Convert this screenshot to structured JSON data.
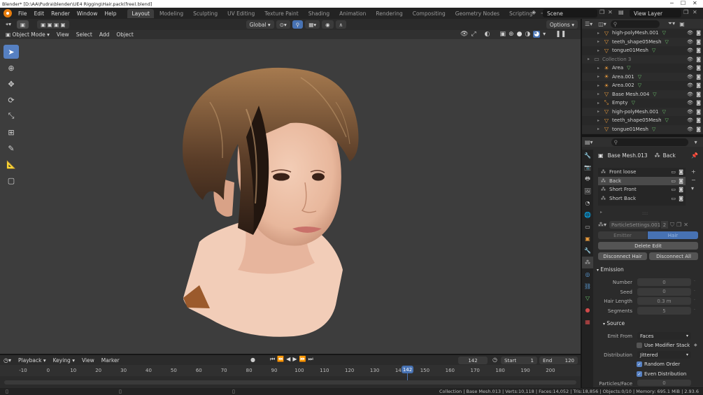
{
  "titlebar": {
    "title": "Blender* [D:\\AA\\Pudra\\blender\\UE4 Rigging\\Hair.pack(free).blend]"
  },
  "menu": [
    "File",
    "Edit",
    "Render",
    "Window",
    "Help"
  ],
  "workspaces": [
    "Layout",
    "Modeling",
    "Sculpting",
    "UV Editing",
    "Texture Paint",
    "Shading",
    "Animation",
    "Rendering",
    "Compositing",
    "Geometry Nodes",
    "Scripting"
  ],
  "scene": {
    "name": "Scene",
    "view_layer": "View Layer"
  },
  "viewport_header": {
    "mode": "Object Mode",
    "menus": [
      "View",
      "Select",
      "Add",
      "Object"
    ],
    "transform": "Global",
    "options": "Options"
  },
  "outliner": {
    "search_placeholder": "",
    "rows": [
      {
        "name": "high-polyMesh.001",
        "icon": "mesh-icon",
        "indent": 1
      },
      {
        "name": "teeth_shape05Mesh",
        "icon": "mesh-icon",
        "indent": 1
      },
      {
        "name": "tongue01Mesh",
        "icon": "mesh-icon",
        "indent": 1
      },
      {
        "name": "Collection 3",
        "icon": "collection-icon",
        "indent": 0,
        "dim": true
      },
      {
        "name": "Area",
        "icon": "light-icon",
        "indent": 1
      },
      {
        "name": "Area.001",
        "icon": "light-icon",
        "indent": 1
      },
      {
        "name": "Area.002",
        "icon": "light-icon",
        "indent": 1
      },
      {
        "name": "Base Mesh.004",
        "icon": "mesh-icon",
        "indent": 1
      },
      {
        "name": "Empty",
        "icon": "empty-icon",
        "indent": 1
      },
      {
        "name": "high-polyMesh.001",
        "icon": "mesh-icon",
        "indent": 1
      },
      {
        "name": "teeth_shape05Mesh",
        "icon": "mesh-icon",
        "indent": 1
      },
      {
        "name": "tongue01Mesh",
        "icon": "mesh-icon",
        "indent": 1
      }
    ]
  },
  "properties": {
    "object": "Base Mesh.013",
    "system": "Back",
    "particle_systems": [
      "Front loose",
      "Back",
      "Short Front",
      "Short Back"
    ],
    "selected_system": "Back",
    "settings_name": "ParticleSettings.001",
    "users": "2",
    "type_tabs": [
      "Emitter",
      "Hair"
    ],
    "buttons": {
      "delete_edit": "Delete Edit",
      "disconnect_hair": "Disconnect Hair",
      "disconnect_all": "Disconnect All"
    },
    "emission": {
      "title": "Emission",
      "fields": [
        {
          "label": "Number",
          "value": "0"
        },
        {
          "label": "Seed",
          "value": "0"
        },
        {
          "label": "Hair Length",
          "value": "0.3 m"
        },
        {
          "label": "Segments",
          "value": "5"
        }
      ]
    },
    "source": {
      "title": "Source",
      "emit_from_label": "Emit From",
      "emit_from": "Faces",
      "use_modifier_stack": "Use Modifier Stack",
      "distribution_label": "Distribution",
      "distribution": "Jittered",
      "random_order": "Random Order",
      "even_distribution": "Even Distribution",
      "particles_face_label": "Particles/Face",
      "particles_face": "0"
    }
  },
  "timeline": {
    "menus": [
      "Playback",
      "Keying",
      "View",
      "Marker"
    ],
    "current_frame": "142",
    "start_label": "Start",
    "start": "1",
    "end_label": "End",
    "end": "120",
    "ticks": [
      "-10",
      "0",
      "10",
      "20",
      "30",
      "40",
      "50",
      "60",
      "70",
      "80",
      "90",
      "100",
      "110",
      "120",
      "130",
      "140",
      "150",
      "160",
      "170",
      "180",
      "190",
      "200"
    ],
    "playhead": "142"
  },
  "statusbar": {
    "text": "Collection | Base Mesh.013 | Verts:10,118 | Faces:14,052 | Tris:18,856 | Objects:0/10 | Memory: 695.1 MiB | 2.93.6"
  },
  "colors": {
    "accent": "#4772b3",
    "selected_tab": "#5680c2",
    "object_orange": "#e89a3c",
    "mesh_green": "#6bc36b"
  }
}
